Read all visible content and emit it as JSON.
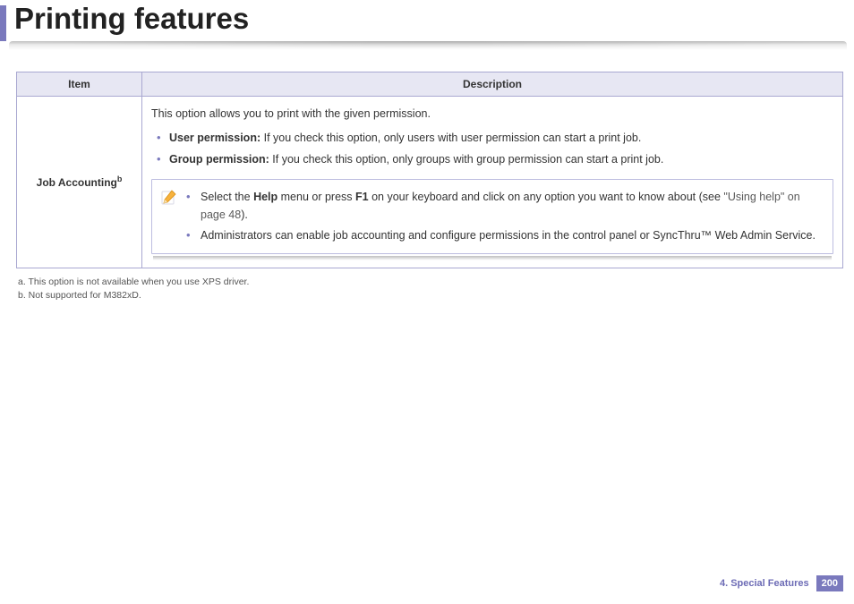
{
  "header": {
    "title": "Printing features"
  },
  "table": {
    "headers": {
      "item": "Item",
      "description": "Description"
    },
    "row": {
      "item_label": "Job Accounting",
      "item_sup": "b",
      "intro": "This option allows you to print with the given permission.",
      "bullet1_strong": "User permission:",
      "bullet1_rest": " If you check this option, only users with user permission can start a print job.",
      "bullet2_strong": "Group permission:",
      "bullet2_rest": " If you check this option, only groups with group permission can start a print job.",
      "note1_pre": "Select the ",
      "note1_help": "Help",
      "note1_mid": " menu or press ",
      "note1_f1": "F1",
      "note1_post": " on your keyboard and click on any option you want to know about (see ",
      "note1_link": "\"Using help\" on page 48",
      "note1_end": ").",
      "note2_pre": "Administrators can enable job accounting and configure permissions in the control panel or ",
      "note2_link": "SyncThru™ Web Admin Service",
      "note2_end": "."
    }
  },
  "footnotes": {
    "a": "a.  This option is not available when you use XPS driver.",
    "b": "b. Not supported for M382xD."
  },
  "footer": {
    "chapter": "4.  Special Features",
    "page": "200"
  }
}
